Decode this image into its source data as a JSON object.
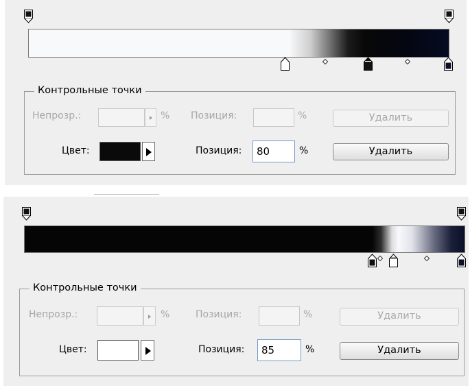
{
  "colors": {
    "panel_bg": "#efefef",
    "stop_dark": "#0a0a0a",
    "stop_white": "#ffffff",
    "accent_border": "#6f97c9"
  },
  "panels": [
    {
      "group_title": "Контрольные точки",
      "opacity_label": "Непрозр.:",
      "opacity_value": "",
      "opacity_unit": "%",
      "opacity_position_label": "Позиция:",
      "opacity_position_value": "",
      "opacity_position_unit": "%",
      "opacity_delete_label": "Удалить",
      "color_label": "Цвет:",
      "color_swatch": "#0a0a0a",
      "color_position_label": "Позиция:",
      "color_position_value": "80",
      "color_position_unit": "%",
      "color_delete_label": "Удалить",
      "gradient_stops_percent": [
        62,
        80,
        100
      ],
      "selected_stop_percent": 80
    },
    {
      "group_title": "Контрольные точки",
      "opacity_label": "Непрозр.:",
      "opacity_value": "",
      "opacity_unit": "%",
      "opacity_position_label": "Позиция:",
      "opacity_position_value": "",
      "opacity_position_unit": "%",
      "opacity_delete_label": "Удалить",
      "color_label": "Цвет:",
      "color_swatch": "#ffffff",
      "color_position_label": "Позиция:",
      "color_position_value": "85",
      "color_position_unit": "%",
      "color_delete_label": "Удалить",
      "gradient_stops_percent": [
        80,
        85,
        100
      ],
      "selected_stop_percent": 85
    }
  ]
}
